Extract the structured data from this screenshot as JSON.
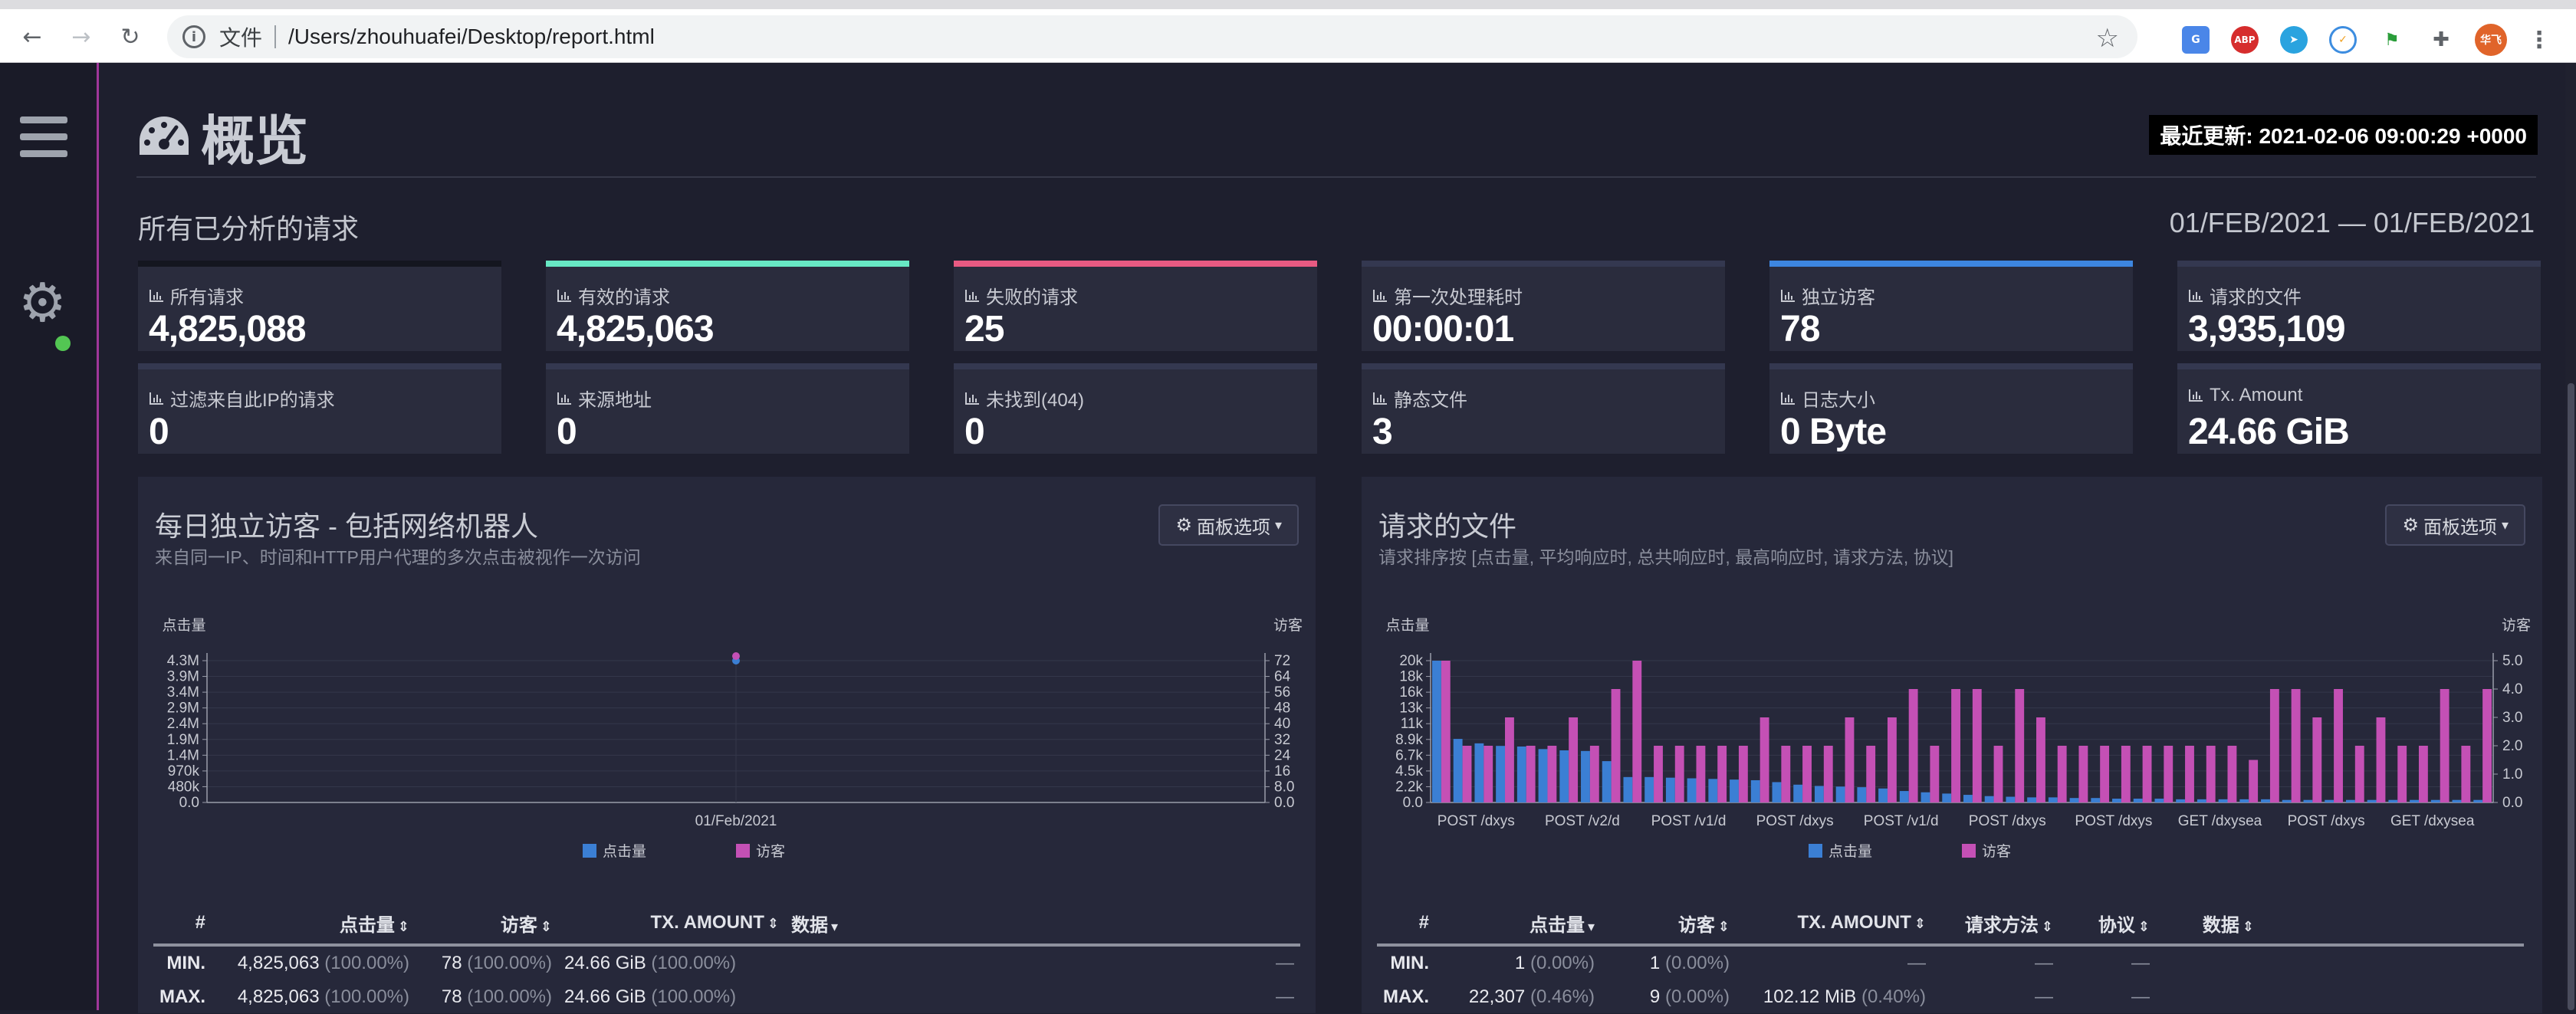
{
  "browser": {
    "scheme_label": "文件",
    "url": "/Users/zhouhuafei/Desktop/report.html",
    "avatar_text": "华飞",
    "extensions": [
      "translate-icon",
      "abp-icon",
      "telegram-icon",
      "loader-icon",
      "flag-icon",
      "puzzle-icon"
    ]
  },
  "header": {
    "title": "概览",
    "updated_label": "最近更新: 2021-02-06 09:00:29 +0000",
    "section_title": "所有已分析的请求",
    "date_range": "01/FEB/2021 — 01/FEB/2021"
  },
  "stats": [
    {
      "label": "所有请求",
      "value": "4,825,088",
      "accent": "#14161f"
    },
    {
      "label": "有效的请求",
      "value": "4,825,063",
      "accent": "#67e8c4"
    },
    {
      "label": "失败的请求",
      "value": "25",
      "accent": "#e85a82"
    },
    {
      "label": "第一次处理耗时",
      "value": "00:00:01",
      "accent": "#343850"
    },
    {
      "label": "独立访客",
      "value": "78",
      "accent": "#3d86e0"
    },
    {
      "label": "请求的文件",
      "value": "3,935,109",
      "accent": "#343850"
    },
    {
      "label": "过滤来自此IP的请求",
      "value": "0",
      "accent": "#343850"
    },
    {
      "label": "来源地址",
      "value": "0",
      "accent": "#343850"
    },
    {
      "label": "未找到(404)",
      "value": "0",
      "accent": "#343850"
    },
    {
      "label": "静态文件",
      "value": "3",
      "accent": "#343850"
    },
    {
      "label": "日志大小",
      "value": "0 Byte",
      "accent": "#343850"
    },
    {
      "label": "Tx. Amount",
      "value": "24.66 GiB",
      "accent": "#343850"
    }
  ],
  "panel_left": {
    "title": "每日独立访客 - 包括网络机器人",
    "subtitle": "来自同一IP、时间和HTTP用户代理的多次点击被视作一次访问",
    "options_button": "面板选项",
    "table": {
      "headers": [
        "#",
        "点击量",
        "访客",
        "TX. AMOUNT",
        "数据"
      ],
      "rows": [
        {
          "label": "MIN.",
          "hits": "4,825,063",
          "hits_pct": "(100.00%)",
          "visitors": "78",
          "visitors_pct": "(100.00%)",
          "tx": "24.66 GiB",
          "tx_pct": "(100.00%)",
          "data": "—"
        },
        {
          "label": "MAX.",
          "hits": "4,825,063",
          "hits_pct": "(100.00%)",
          "visitors": "78",
          "visitors_pct": "(100.00%)",
          "tx": "24.66 GiB",
          "tx_pct": "(100.00%)",
          "data": "—"
        }
      ]
    }
  },
  "panel_right": {
    "title": "请求的文件",
    "subtitle": "请求排序按 [点击量, 平均响应时, 总共响应时, 最高响应时, 请求方法, 协议]",
    "options_button": "面板选项",
    "table": {
      "headers": [
        "#",
        "点击量",
        "访客",
        "TX. AMOUNT",
        "请求方法",
        "协议",
        "数据"
      ],
      "rows": [
        {
          "label": "MIN.",
          "hits": "1",
          "hits_pct": "(0.00%)",
          "visitors": "1",
          "visitors_pct": "(0.00%)",
          "tx": "—",
          "tx_pct": "",
          "method": "—",
          "proto": "—",
          "data": ""
        },
        {
          "label": "MAX.",
          "hits": "22,307",
          "hits_pct": "(0.46%)",
          "visitors": "9",
          "visitors_pct": "(0.00%)",
          "tx": "102.12 MiB",
          "tx_pct": "(0.40%)",
          "method": "—",
          "proto": "—",
          "data": ""
        }
      ]
    }
  },
  "chart_data": [
    {
      "type": "line",
      "categories": [
        "01/Feb/2021"
      ],
      "series": [
        {
          "name": "点击量",
          "axis": "left",
          "color": "#3b7fd4",
          "values": [
            4825063
          ]
        },
        {
          "name": "访客",
          "axis": "right",
          "color": "#c450b5",
          "values": [
            78
          ]
        }
      ],
      "ylabel_left": "点击量",
      "ylabel_right": "访客",
      "yticks_left": [
        "0.0",
        "480k",
        "970k",
        "1.4M",
        "1.9M",
        "2.4M",
        "2.9M",
        "3.4M",
        "3.9M",
        "4.3M"
      ],
      "yticks_right": [
        "0.0",
        "8.0",
        "16",
        "24",
        "32",
        "40",
        "48",
        "56",
        "64",
        "72"
      ],
      "ylim_left": [
        0,
        4825063
      ],
      "ylim_right": [
        0,
        78
      ],
      "legend": "bottom-center"
    },
    {
      "type": "bar",
      "categories": [
        "POST /dxys",
        "POST /v2/d",
        "POST /v1/d",
        "POST /dxys",
        "POST /v1/d",
        "POST /dxys",
        "POST /dxys",
        "GET /dxysea",
        "POST /dxys",
        "GET /dxysea"
      ],
      "series": [
        {
          "name": "点击量",
          "axis": "left",
          "color": "#3b7fd4",
          "values": [
            22307,
            10000,
            9300,
            8900,
            8800,
            8400,
            8200,
            8100,
            6500,
            4000,
            4000,
            3900,
            3800,
            3700,
            3600,
            3500,
            3200,
            2800,
            2600,
            2500,
            2400,
            2200,
            1800,
            1600,
            1400,
            1200,
            1000,
            900,
            800,
            800,
            700,
            700,
            600,
            600,
            600,
            500,
            500,
            500,
            500,
            500,
            400,
            400,
            400,
            400,
            400,
            400,
            400,
            400,
            400,
            400
          ]
        },
        {
          "name": "访客",
          "axis": "right",
          "color": "#c450b5",
          "values": [
            5.0,
            2.0,
            2.0,
            3.0,
            2.0,
            2.0,
            3.0,
            2.0,
            4.0,
            5.0,
            2.0,
            2.0,
            2.0,
            2.0,
            2.0,
            3.0,
            2.0,
            2.0,
            2.0,
            3.0,
            2.0,
            3.0,
            4.0,
            2.0,
            4.0,
            4.0,
            2.0,
            4.0,
            3.0,
            2.0,
            2.0,
            2.0,
            2.0,
            2.0,
            2.0,
            2.0,
            2.0,
            2.0,
            1.5,
            4.0,
            4.0,
            3.0,
            4.0,
            2.0,
            3.0,
            2.0,
            2.0,
            4.0,
            2.0,
            4.0
          ]
        },
        {
          "name": "",
          "axis": "right",
          "color": "#c450b5",
          "values": []
        }
      ],
      "ylabel_left": "点击量",
      "ylabel_right": "访客",
      "yticks_left": [
        "0.0",
        "2.2k",
        "4.5k",
        "6.7k",
        "8.9k",
        "11k",
        "13k",
        "16k",
        "18k",
        "20k"
      ],
      "yticks_right": [
        "0.0",
        "1.0",
        "2.0",
        "3.0",
        "4.0",
        "5.0"
      ],
      "ylim_left": [
        0,
        22307
      ],
      "ylim_right": [
        0,
        5.0
      ],
      "legend": "bottom-center"
    }
  ]
}
